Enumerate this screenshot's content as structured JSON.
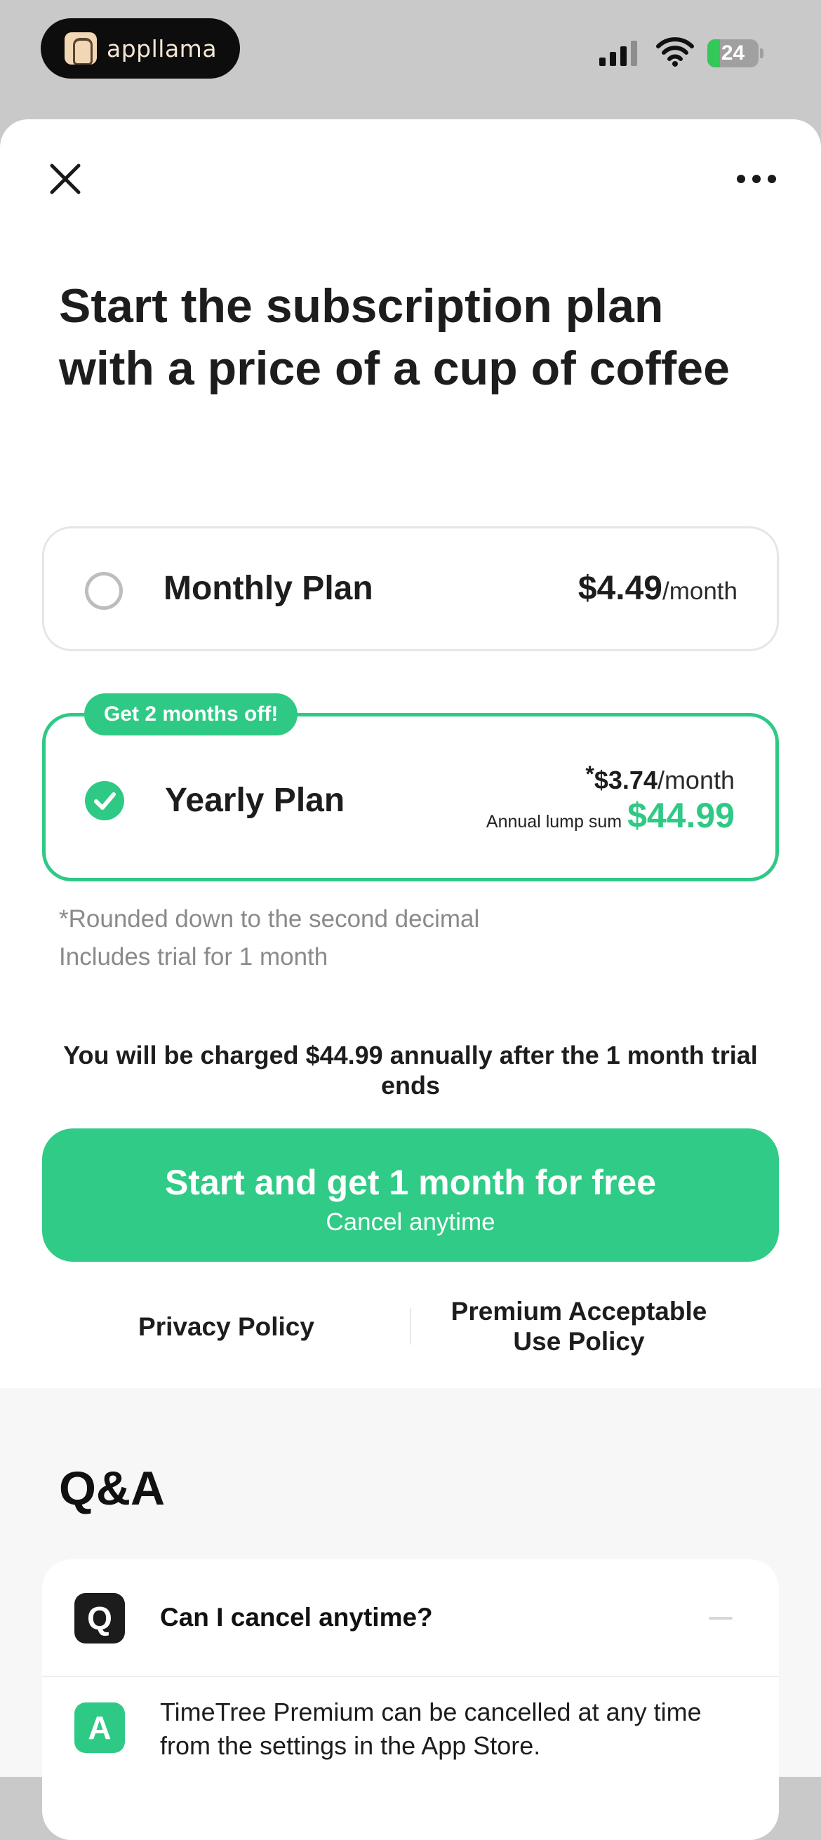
{
  "status_bar": {
    "app_name": "appllama",
    "battery_level": "24",
    "battery_fraction": 0.24
  },
  "header": {
    "close_icon": "close-icon",
    "more_icon": "more-icon"
  },
  "headline": "Start the subscription plan with a price of a cup of coffee",
  "plans": {
    "monthly": {
      "name": "Monthly Plan",
      "price": "$4.49",
      "unit": "/month",
      "selected": false
    },
    "yearly": {
      "badge": "Get 2 months off!",
      "name": "Yearly Plan",
      "asterisk": "*",
      "per_month_price": "$3.74",
      "unit": "/month",
      "lump_label": "Annual lump sum",
      "lump_price": "$44.99",
      "selected": true
    }
  },
  "footnotes": {
    "rounding": "*Rounded down to the second decimal",
    "trial": "Includes trial for 1 month"
  },
  "charge_note": "You will be charged $44.99 annually after the 1 month trial ends",
  "cta": {
    "main": "Start and get 1 month for free",
    "sub": "Cancel anytime"
  },
  "links": {
    "privacy": "Privacy Policy",
    "acceptable_use": "Premium Acceptable Use Policy"
  },
  "qa": {
    "title": "Q&A",
    "q_badge": "Q",
    "a_badge": "A",
    "items": [
      {
        "question": "Can I cancel anytime?",
        "answer": "TimeTree Premium can be cancelled at any time from the settings in the App Store."
      }
    ]
  },
  "colors": {
    "accent": "#2fc986",
    "status_bar_bg": "#c9c9c9",
    "battery_fill": "#34c759"
  }
}
